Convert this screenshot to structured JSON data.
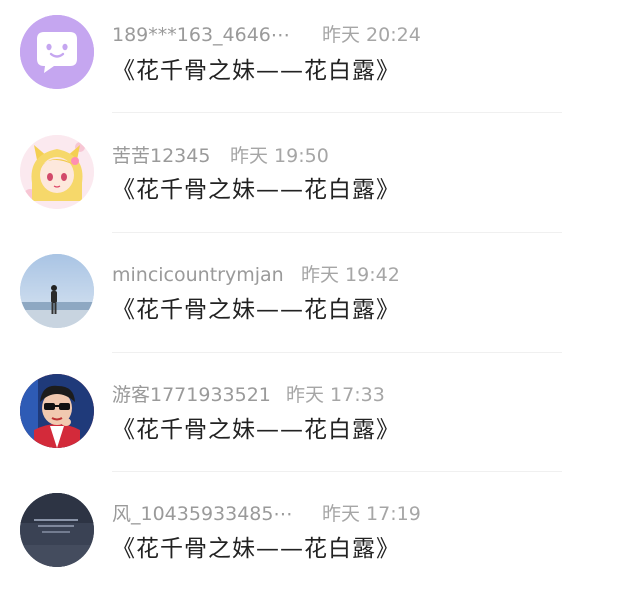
{
  "comments": [
    {
      "username": "189***163_4646⋯",
      "time": "昨天 20:24",
      "content": "《花千骨之妹——花白露》",
      "avatar_icon": "chat-bubble-smile-icon",
      "avatar_color": "#c9a9f2"
    },
    {
      "username": "苦苦12345",
      "time": "昨天 19:50",
      "content": "《花千骨之妹——花白露》",
      "avatar_icon": "anime-girl-avatar",
      "avatar_color": "#f6d86a"
    },
    {
      "username": "mincicountrymjan",
      "time": "昨天 19:42",
      "content": "《花千骨之妹——花白露》",
      "avatar_icon": "person-seaside-photo-avatar",
      "avatar_color": "#b9cfe6"
    },
    {
      "username": "游客1771933521",
      "time": "昨天 17:33",
      "content": "《花千骨之妹——花白露》",
      "avatar_icon": "person-sunglasses-photo-avatar",
      "avatar_color": "#c8283a"
    },
    {
      "username": "风_10435933485⋯",
      "time": "昨天 17:19",
      "content": "《花千骨之妹——花白露》",
      "avatar_icon": "dark-text-photo-avatar",
      "avatar_color": "#3c4456"
    }
  ]
}
